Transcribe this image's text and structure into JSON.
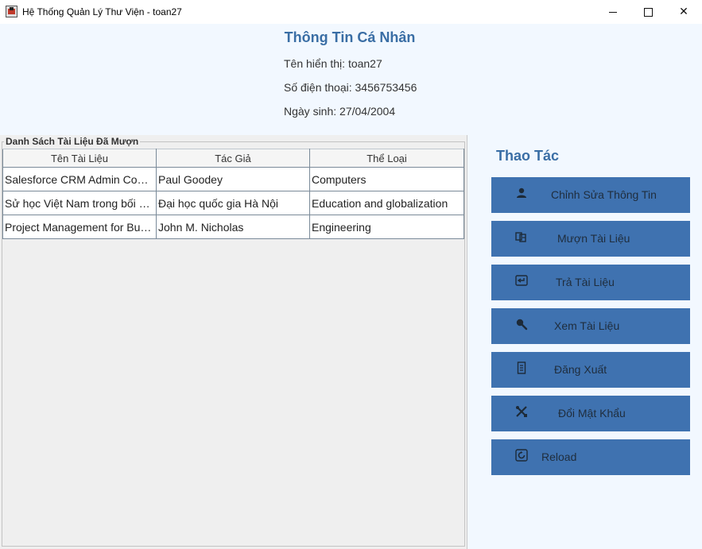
{
  "window": {
    "title": "Hệ Thống Quản Lý Thư Viện - toan27"
  },
  "profile": {
    "title": "Thông Tin Cá Nhân",
    "display_name": "Tên hiển thị: toan27",
    "phone": "Số điện thoại: 3456753456",
    "birthday": "Ngày sinh: 27/04/2004"
  },
  "borrowed": {
    "group_title": "Danh Sách Tài Liệu Đã Mượn",
    "columns": [
      "Tên Tài Liệu",
      "Tác Giả",
      "Thể Loại"
    ],
    "rows": [
      [
        "Salesforce CRM Admin Cook...",
        "Paul Goodey",
        "Computers"
      ],
      [
        "Sử học Việt Nam trong bối cả...",
        "Đại học quốc gia Hà Nội",
        "Education and globalization"
      ],
      [
        "Project Management for Busi...",
        "John M. Nicholas",
        "Engineering"
      ]
    ]
  },
  "actions": {
    "title": "Thao Tác",
    "buttons": [
      {
        "label": "Chỉnh Sửa Thông Tin",
        "icon": "user-icon"
      },
      {
        "label": "Mượn Tài Liệu",
        "icon": "borrow-icon"
      },
      {
        "label": "Trả Tài Liệu",
        "icon": "return-icon"
      },
      {
        "label": "Xem Tài Liệu",
        "icon": "search-icon"
      },
      {
        "label": "Đăng Xuất",
        "icon": "logout-icon"
      },
      {
        "label": "Đổi Mật Khẩu",
        "icon": "tools-icon"
      },
      {
        "label": "Reload",
        "icon": "reload-icon"
      }
    ]
  },
  "colors": {
    "accent": "#3a6ea5",
    "button": "#3f72b0",
    "background": "#f2f8ff"
  }
}
